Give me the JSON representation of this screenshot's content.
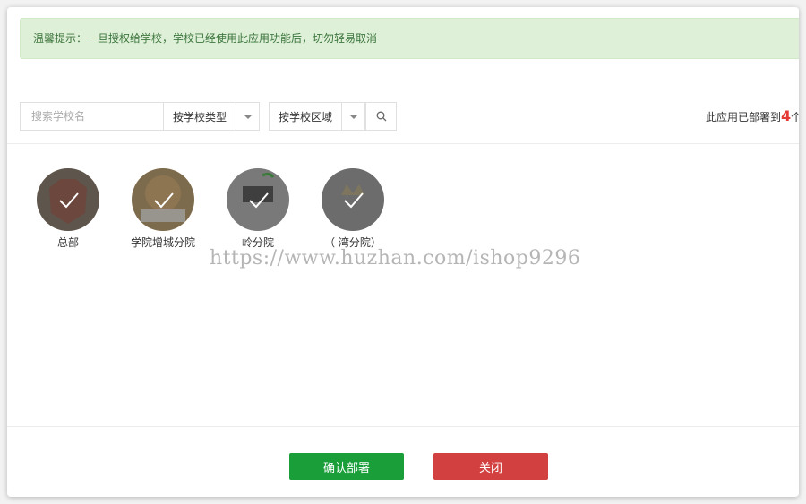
{
  "tip": {
    "text": "温馨提示：一旦授权给学校，学校已经使用此应用功能后，切勿轻易取消"
  },
  "search": {
    "placeholder": "搜索学校名"
  },
  "filters": {
    "type_label": "按学校类型",
    "region_label": "按学校区域"
  },
  "count": {
    "prefix": "此应用已部署到",
    "number": "4",
    "suffix": "个"
  },
  "schools": [
    {
      "name": "总部"
    },
    {
      "name": "学院增城分院"
    },
    {
      "name": "岭分院"
    },
    {
      "name": "（ 湾分院）"
    }
  ],
  "watermark": "https://www.huzhan.com/ishop9296",
  "footer": {
    "confirm_label": "确认部署",
    "close_label": "关闭"
  },
  "colors": {
    "tip_bg": "#dff0d8",
    "confirm": "#1a9e3a",
    "close": "#d34040",
    "count_number": "#e53935"
  }
}
